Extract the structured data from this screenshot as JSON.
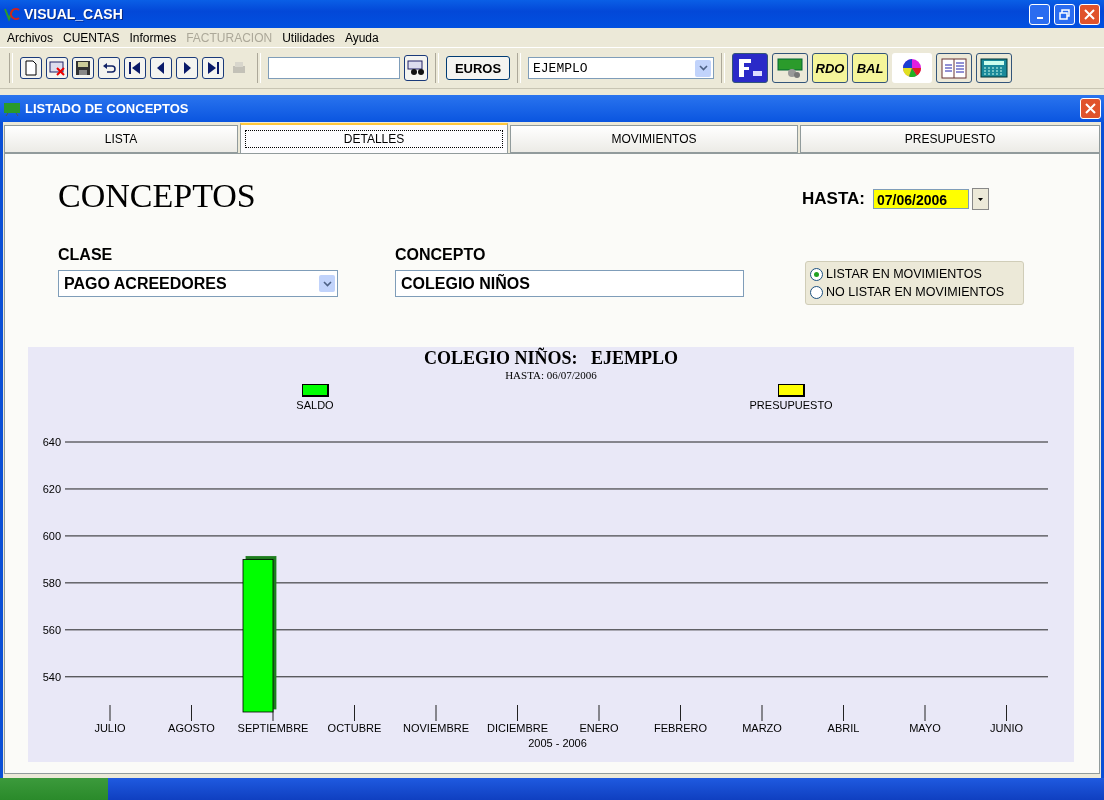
{
  "window": {
    "title": "VISUAL_CASH"
  },
  "menu": [
    {
      "label": "Archivos",
      "disabled": false
    },
    {
      "label": "CUENTAS",
      "disabled": false
    },
    {
      "label": "Informes",
      "disabled": false
    },
    {
      "label": "FACTURACION",
      "disabled": true
    },
    {
      "label": "Utilidades",
      "disabled": false
    },
    {
      "label": "Ayuda",
      "disabled": false
    }
  ],
  "toolbar": {
    "print_button": {
      "disabled": true
    },
    "currency_button": "EUROS",
    "company_select": "EJEMPLO",
    "report_buttons": [
      "RDO",
      "BAL"
    ]
  },
  "child_window": {
    "title": "LISTADO DE CONCEPTOS",
    "tabs": [
      {
        "label": "LISTA",
        "selected": false
      },
      {
        "label": "DETALLES",
        "selected": true
      },
      {
        "label": "MOVIMIENTOS",
        "selected": false
      },
      {
        "label": "PRESUPUESTO",
        "selected": false
      }
    ],
    "heading": "CONCEPTOS",
    "date_label": "HASTA:",
    "date_value": "07/06/2006",
    "class_label": "CLASE",
    "class_value": "PAGO ACREEDORES",
    "concept_label": "CONCEPTO",
    "concept_value": "COLEGIO NIÑOS",
    "list_options": [
      {
        "label": "LISTAR EN MOVIMIENTOS",
        "selected": true
      },
      {
        "label": "NO LISTAR EN MOVIMIENTOS",
        "selected": false
      }
    ],
    "chart_data": {
      "type": "bar",
      "title": "COLEGIO NIÑOS:   EJEMPLO",
      "subtitle": "HASTA: 06/07/2006",
      "xlabel": "2005 - 2006",
      "categories": [
        "JULIO",
        "AGOSTO",
        "SEPTIEMBRE",
        "OCTUBRE",
        "NOVIEMBRE",
        "DICIEMBRE",
        "ENERO",
        "FEBRERO",
        "MARZO",
        "ABRIL",
        "MAYO",
        "JUNIO"
      ],
      "series": [
        {
          "name": "SALDO",
          "color": "#00ff00",
          "values": [
            null,
            null,
            590,
            null,
            null,
            null,
            null,
            null,
            null,
            null,
            null,
            null
          ]
        },
        {
          "name": "PRESUPUESTO",
          "color": "#ffff00",
          "values": [
            null,
            null,
            null,
            null,
            null,
            null,
            null,
            null,
            null,
            null,
            null,
            null
          ]
        }
      ],
      "ylim": [
        525,
        640
      ],
      "yticks": [
        540,
        560,
        580,
        600,
        620,
        640
      ],
      "grid": true
    }
  }
}
